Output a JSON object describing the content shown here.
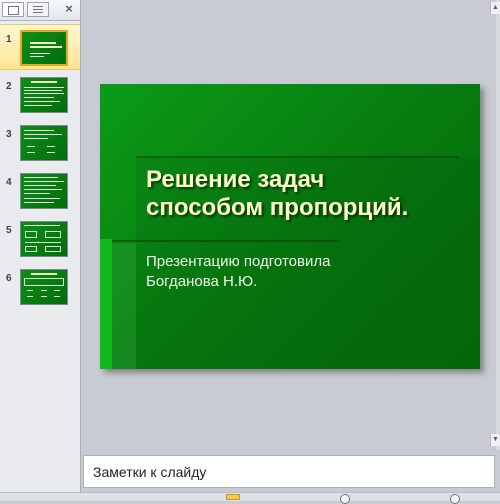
{
  "panel": {
    "tabs": [
      {
        "name": "slides-tab",
        "icon": "slides-icon"
      },
      {
        "name": "outline-tab",
        "icon": "outline-icon"
      }
    ],
    "close_label": "×"
  },
  "thumbnails": [
    {
      "number": "1",
      "selected": true
    },
    {
      "number": "2",
      "selected": false
    },
    {
      "number": "3",
      "selected": false
    },
    {
      "number": "4",
      "selected": false
    },
    {
      "number": "5",
      "selected": false
    },
    {
      "number": "6",
      "selected": false
    }
  ],
  "slide": {
    "title_line1": "Решение задач",
    "title_line2": "способом пропорций.",
    "subtitle_line1": "Презентацию подготовила",
    "subtitle_line2": "Богданова Н.Ю.",
    "colors": {
      "background": "#077a0f",
      "title": "#ffffc8",
      "subtitle": "#f0f8e8"
    }
  },
  "notes": {
    "placeholder": "Заметки к слайду"
  },
  "scrollbar": {
    "up_arrow": "▲",
    "down_arrow": "▼"
  }
}
